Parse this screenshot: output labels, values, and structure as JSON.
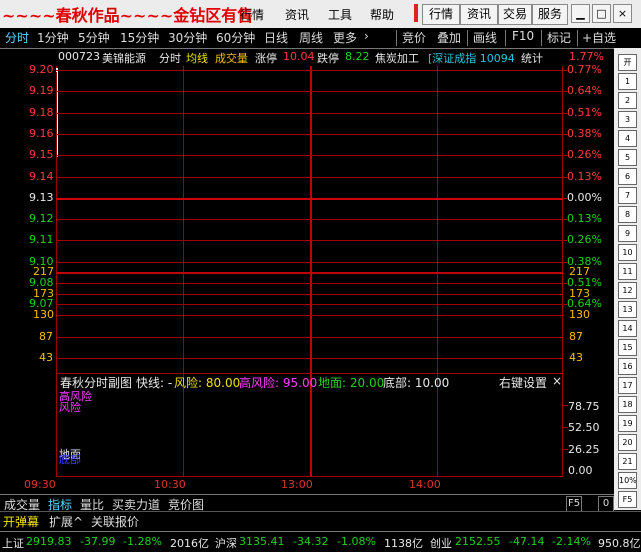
{
  "title_bar": {
    "brand": "~~~~春秋作品~~~~金钻区有售",
    "menus": [
      "行情",
      "资讯",
      "工具",
      "帮助"
    ],
    "right_buttons": [
      "行情",
      "资讯",
      "交易",
      "服务"
    ],
    "window_controls": [
      "▁",
      "□",
      "×"
    ]
  },
  "period_tabs": [
    "分时",
    "1分钟",
    "5分钟",
    "15分钟",
    "30分钟",
    "60分钟",
    "日线",
    "周线",
    "更多"
  ],
  "more_arrow": "›",
  "right_tabs": [
    "竞价",
    "叠加",
    "画线",
    "F10",
    "标记",
    "+自选"
  ],
  "info_line": {
    "code": "000723",
    "name": "美锦能源",
    "mode": "分时",
    "avg": "均线",
    "vol": "成交量",
    "rise_label": "涨停",
    "rise_value": "10.04",
    "fall_label": "跌停",
    "fall_value": "8.22",
    "sector": "焦炭加工",
    "index_text": "[深证成指 10094",
    "stats_label": "统计",
    "top_right_pct": "1.77%"
  },
  "price_axis": {
    "left_labels": [
      "9.20",
      "9.19",
      "9.18",
      "9.16",
      "9.15",
      "9.14",
      "9.13",
      "9.12",
      "9.11",
      "9.10",
      "9.08",
      "9.07"
    ],
    "right_labels": [
      "0.77%",
      "0.64%",
      "0.51%",
      "0.38%",
      "0.26%",
      "0.13%",
      "0.00%",
      "0.13%",
      "0.26%",
      "0.38%",
      "0.51%",
      "0.64%"
    ],
    "colors": [
      "red",
      "red",
      "red",
      "red",
      "red",
      "red",
      "white",
      "green",
      "green",
      "green",
      "green",
      "green"
    ]
  },
  "volume_axis": {
    "left_labels": [
      "217",
      "173",
      "130",
      "87",
      "43"
    ],
    "right_labels": [
      "217",
      "173",
      "130",
      "87",
      "43"
    ]
  },
  "sub_chart": {
    "title": "春秋分时副图",
    "fast_label": "快线: -",
    "risk_label": "风险: 80.00",
    "high_risk_label": "高风险: 95.00",
    "ground_label": "地面: 20.00",
    "bottom_label": "底部: 10.00",
    "settings": "右键设置",
    "close": "×",
    "inner_top1": "高风险",
    "inner_top2": "风险",
    "inner_bottom1": "地面",
    "inner_bottom2": "底部",
    "axis": [
      "78.75",
      "52.50",
      "26.25",
      "0.00"
    ]
  },
  "time_axis": [
    "09:30",
    "10:30",
    "13:00",
    "14:00"
  ],
  "bottom_tabs": [
    "成交量",
    "指标",
    "量比",
    "买卖力道",
    "竞价图"
  ],
  "bottom_ctrl": [
    "F5",
    "0"
  ],
  "bottom_tabs2": [
    "开弹幕",
    "扩展^",
    "关联报价"
  ],
  "status_bar": {
    "sh_label": "上证",
    "sh_value": "2919.83",
    "sh_chg": "-37.99",
    "sh_pct": "-1.28%",
    "sh_amt": "2016亿",
    "hs_label": "沪深",
    "hs_value": "3135.41",
    "hs_chg": "-34.32",
    "hs_pct": "-1.08%",
    "hs_amt": "1138亿",
    "cy_label": "创业",
    "cy_value": "2152.55",
    "cy_chg": "-47.14",
    "cy_pct": "-2.14%",
    "cy_amt": "950.8亿"
  },
  "right_toolbar_icons": [
    "开",
    "1",
    "2",
    "3",
    "4",
    "5",
    "6",
    "7",
    "8",
    "9",
    "10",
    "11",
    "12",
    "13",
    "14",
    "15",
    "16",
    "17",
    "18",
    "19",
    "20",
    "21",
    "10%",
    "F5"
  ]
}
